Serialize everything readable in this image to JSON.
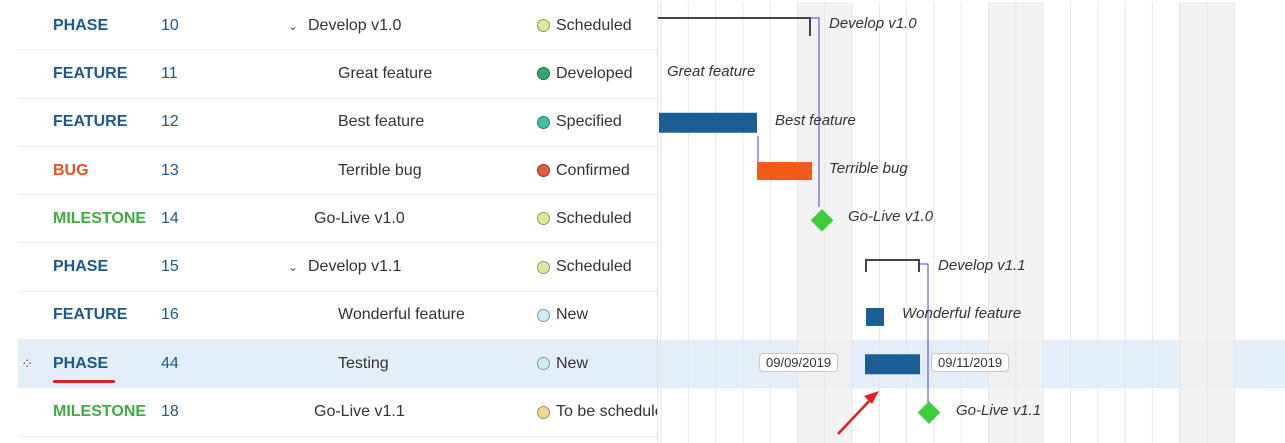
{
  "colors": {
    "phase": "#1a5a8c",
    "feature": "#1a5a8c",
    "bug": "#e8501e",
    "milestone": "#3cae3c",
    "bar_blue": "#1b5e96",
    "bar_red": "#f05a1a",
    "diamond": "#3ccd3c",
    "link": "#3c3cff",
    "selected_row": "#e3eef8"
  },
  "rows": [
    {
      "type": "PHASE",
      "type_color": "#1a5a8c",
      "id": "10",
      "subject": "Develop v1.0",
      "expander": "⌄",
      "indent": 0,
      "status": "Scheduled",
      "status_color": "#d7ec9a"
    },
    {
      "type": "FEATURE",
      "type_color": "#1a5a8c",
      "id": "11",
      "subject": "Great feature",
      "expander": "",
      "indent": 1,
      "status": "Developed",
      "status_color": "#2eaa6c"
    },
    {
      "type": "FEATURE",
      "type_color": "#1a5a8c",
      "id": "12",
      "subject": "Best feature",
      "expander": "",
      "indent": 1,
      "status": "Specified",
      "status_color": "#3ec2a0"
    },
    {
      "type": "BUG",
      "type_color": "#e8501e",
      "id": "13",
      "subject": "Terrible bug",
      "expander": "",
      "indent": 1,
      "status": "Confirmed",
      "status_color": "#e35a3c"
    },
    {
      "type": "MILESTONE",
      "type_color": "#3cae3c",
      "id": "14",
      "subject": "Go-Live v1.0",
      "expander": "",
      "indent": 0,
      "status": "Scheduled",
      "status_color": "#d7ec9a"
    },
    {
      "type": "PHASE",
      "type_color": "#1a5a8c",
      "id": "15",
      "subject": "Develop v1.1",
      "expander": "⌄",
      "indent": 0,
      "status": "Scheduled",
      "status_color": "#d7ec9a"
    },
    {
      "type": "FEATURE",
      "type_color": "#1a5a8c",
      "id": "16",
      "subject": "Wonderful feature",
      "expander": "",
      "indent": 1,
      "status": "New",
      "status_color": "#cdeef0"
    },
    {
      "type": "PHASE",
      "type_color": "#1a5a8c",
      "id": "44",
      "subject": "Testing",
      "expander": "",
      "indent": 1,
      "status": "New",
      "status_color": "#cdeef0",
      "selected": true
    },
    {
      "type": "MILESTONE",
      "type_color": "#3cae3c",
      "id": "18",
      "subject": "Go-Live v1.1",
      "expander": "",
      "indent": 0,
      "status": "To be scheduled",
      "status_color": "#f2d98c"
    }
  ],
  "gantt": {
    "labels": [
      "Develop v1.0",
      "Great feature",
      "Best feature",
      "Terrible bug",
      "Go-Live v1.0",
      "Develop v1.1",
      "Wonderful feature",
      "",
      "Go-Live v1.1"
    ],
    "start_date": "09/09/2019",
    "end_date": "09/11/2019"
  }
}
